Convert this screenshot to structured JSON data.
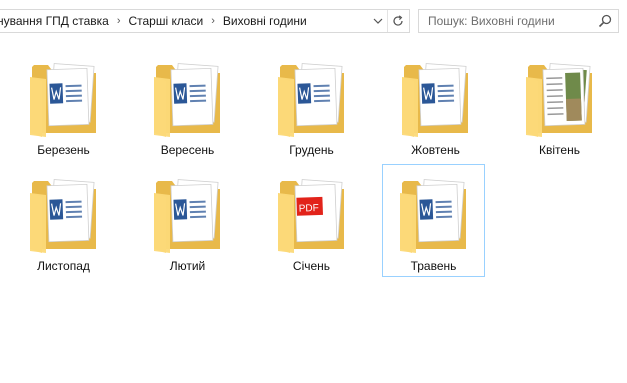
{
  "breadcrumb": {
    "items": [
      "нування ГПД ставка",
      "Старші класи",
      "Виховні години"
    ],
    "separator": "›"
  },
  "search": {
    "placeholder": "Пошук: Виховні години"
  },
  "icons": {
    "dropdown": "chevron-down-icon",
    "refresh": "refresh-icon",
    "search": "search-icon"
  },
  "colors": {
    "folder_back": "#e8b94a",
    "folder_front": "#fcd978",
    "word_blue": "#2b5797",
    "pdf_red": "#e2231a",
    "selection_border": "#99d1ff"
  },
  "folders": [
    {
      "name": "Березень",
      "preview": "word"
    },
    {
      "name": "Вересень",
      "preview": "word"
    },
    {
      "name": "Грудень",
      "preview": "word"
    },
    {
      "name": "Жовтень",
      "preview": "word"
    },
    {
      "name": "Квітень",
      "preview": "image"
    },
    {
      "name": "Листопад",
      "preview": "word"
    },
    {
      "name": "Лютий",
      "preview": "word"
    },
    {
      "name": "Січень",
      "preview": "pdf"
    },
    {
      "name": "Травень",
      "preview": "word",
      "selected": true
    }
  ]
}
